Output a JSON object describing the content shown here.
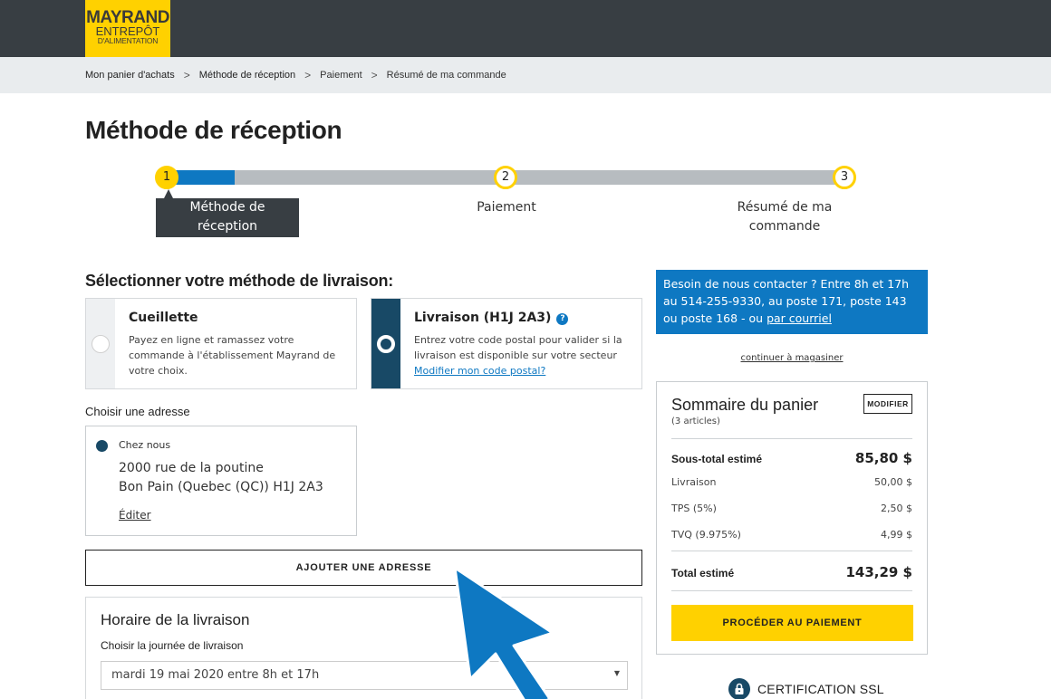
{
  "logo": {
    "line1": "MAYRAND",
    "line2": "ENTREPÔT",
    "line3": "D'ALIMENTATION"
  },
  "breadcrumb": [
    "Mon panier d'achats",
    "Méthode de réception",
    "Paiement",
    "Résumé de ma commande"
  ],
  "page_title": "Méthode de réception",
  "steps": [
    {
      "num": "1",
      "label_line1": "Méthode de",
      "label_line2": "réception"
    },
    {
      "num": "2",
      "label_line1": "Paiement",
      "label_line2": ""
    },
    {
      "num": "3",
      "label_line1": "Résumé de ma",
      "label_line2": "commande"
    }
  ],
  "delivery": {
    "title": "Sélectionner votre méthode de livraison:",
    "pickup": {
      "title": "Cueillette",
      "desc": "Payez en ligne et ramassez votre commande à l'établissement Mayrand de votre choix."
    },
    "shipping": {
      "title": "Livraison (H1J 2A3)",
      "desc": "Entrez votre code postal pour valider si la livraison est disponible sur votre secteur",
      "link": "Modifier mon code postal?"
    }
  },
  "address": {
    "label": "Choisir une adresse",
    "name": "Chez nous",
    "line1": "2000 rue de la poutine",
    "line2": "Bon Pain (Quebec (QC)) H1J 2A3",
    "edit": "Éditer",
    "add_button": "AJOUTER UNE ADRESSE"
  },
  "schedule": {
    "title": "Horaire de la livraison",
    "label": "Choisir la journée de livraison",
    "selected": "mardi 19 mai 2020 entre 8h et 17h"
  },
  "contact": {
    "text": "Besoin de nous contacter ? Entre 8h et 17h au 514-255-9330, au poste 171, poste 143 ou poste 168 - ou",
    "link": "par courriel"
  },
  "continue_shopping": "continuer à magasiner",
  "summary": {
    "title": "Sommaire du panier",
    "count": "(3 articles)",
    "modify": "MODIFIER",
    "subtotal_label": "Sous-total estimé",
    "subtotal_value": "85,80 $",
    "shipping_label": "Livraison",
    "shipping_value": "50,00 $",
    "tps_label": "TPS (5%)",
    "tps_value": "2,50 $",
    "tvq_label": "TVQ (9.975%)",
    "tvq_value": "4,99 $",
    "total_label": "Total estimé",
    "total_value": "143,29 $",
    "pay_button": "PROCÉDER AU PAIEMENT"
  },
  "ssl": "CERTIFICATION SSL",
  "progress": {
    "current_step": 1,
    "total_steps": 3,
    "fill_fraction": 0.1
  },
  "colors": {
    "brand_yellow": "#ffd100",
    "accent_blue": "#0e78c2",
    "dark": "#383e43",
    "navy": "#184966"
  }
}
